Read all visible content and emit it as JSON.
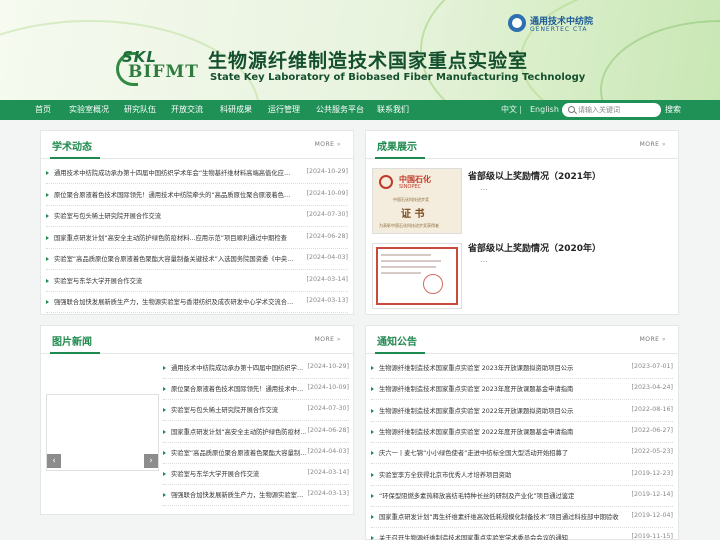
{
  "header": {
    "logo_skl": "SKL",
    "logo_bifmt": "BIFMT",
    "title_cn": "生物源纤维制造技术国家重点实验室",
    "title_en": "State Key Laboratory of Biobased Fiber Manufacturing Technology",
    "partner_name": "通用技术中纺院",
    "partner_en": "GENERTEC CTA"
  },
  "nav": {
    "items": [
      "首页",
      "实验室概况",
      "研究队伍",
      "开放交流",
      "科研成果",
      "运行管理",
      "公共服务平台",
      "联系我们"
    ],
    "lang_cn": "中文",
    "lang_en": "English",
    "search_placeholder": "请输入关键词",
    "search_button": "搜索"
  },
  "colors": {
    "brand_green": "#1f9056",
    "accent_green": "#1f8a4f"
  },
  "academic": {
    "title": "学术动态",
    "more": "MORE",
    "items": [
      {
        "text": "通用技术中纺院成功承办第十四届中国纺织学术年会“生物基纤维材料高端高值化应用...",
        "date": "[2024-10-29]"
      },
      {
        "text": "原位聚合原液着色技术国际领先！通用技术中纺院牵头的“高品质原位聚合原液着色聚...",
        "date": "[2024-10-09]"
      },
      {
        "text": "实验室与包头稀土研究院开展合作交流",
        "date": "[2024-07-30]"
      },
      {
        "text": "国家重点研发计划“高安全主动防护绿色防疫材料...应用示范”项目顺利通过中期检查",
        "date": "[2024-06-28]"
      },
      {
        "text": "实验室“高品质原位聚合原液着色聚酯大容量制备关键技术”入选国务院国资委《中央...",
        "date": "[2024-04-03]"
      },
      {
        "text": "实验室与东华大学开展合作交流",
        "date": "[2024-03-14]"
      },
      {
        "text": "强强联合加快发展新质生产力，生物源实验室与香港纺织及成衣研发中心学术交流合在...",
        "date": "[2024-03-13]"
      }
    ]
  },
  "achievements": {
    "title": "成果展示",
    "more": "MORE",
    "items": [
      {
        "title": "省部级以上奖励情况（2021年）",
        "dots": "...",
        "cert_brand": "中国石化",
        "cert_brand_en": "SINOPEC",
        "cert_sub": "中国石化科技进步奖",
        "cert_word": "证 书",
        "cert_note": "为表彰中国石化科技进步奖获得者"
      },
      {
        "title": "省部级以上奖励情况（2020年）",
        "dots": "..."
      }
    ]
  },
  "photo_news": {
    "title": "图片新闻",
    "more": "MORE",
    "items": [
      {
        "text": "通用技术中纺院成功承办第十四届中国纺织学术...",
        "date": "[2024-10-29]"
      },
      {
        "text": "原位聚合原液着色技术国际领先！通用技术中纺...",
        "date": "[2024-10-09]"
      },
      {
        "text": "实验室与包头稀土研究院开展合作交流",
        "date": "[2024-07-30]"
      },
      {
        "text": "国家重点研发计划“高安全主动防护绿色防疫材...",
        "date": "[2024-06-28]"
      },
      {
        "text": "实验室“高品质原位聚合原液着色聚酯大容量制...",
        "date": "[2024-04-03]"
      },
      {
        "text": "实验室与东华大学开展合作交流",
        "date": "[2024-03-14]"
      },
      {
        "text": "强强联合加快发展新质生产力，生物源实验室与...",
        "date": "[2024-03-13]"
      }
    ]
  },
  "notices": {
    "title": "通知公告",
    "more": "MORE",
    "items": [
      {
        "text": "生物源纤维制造技术国家重点实验室 2023年开放课题拟资助项目公示",
        "date": "[2023-07-01]"
      },
      {
        "text": "生物源纤维制造技术国家重点实验室 2023年度开放课题基金申请指南",
        "date": "[2023-04-24]"
      },
      {
        "text": "生物源纤维制造技术国家重点实验室 2022年开放课题拟资助项目公示",
        "date": "[2022-08-16]"
      },
      {
        "text": "生物源纤维制造技术国家重点实验室 2022年度开放课题基金申请指南",
        "date": "[2022-06-27]"
      },
      {
        "text": "庆六一丨麦七锦“小小绿色使者”走进中纺标全国大型活动开始招募了",
        "date": "[2022-05-23]"
      },
      {
        "text": "实验室李方全获得北京市优秀人才培养项目资助",
        "date": "[2019-12-23]"
      },
      {
        "text": "“环保型阻燃多素热释放高纺毛特种长丝的研制及产业化”项目通过鉴定",
        "date": "[2019-12-14]"
      },
      {
        "text": "国家重点研发计划“再生纤维素纤维高效低耗规模化制备技术”项目通过科技部中期验收",
        "date": "[2019-12-04]"
      },
      {
        "text": "关于召开生物源纤维制造技术国家重点实验室学术委员会会议的通知",
        "date": "[2019-11-15]"
      }
    ]
  }
}
